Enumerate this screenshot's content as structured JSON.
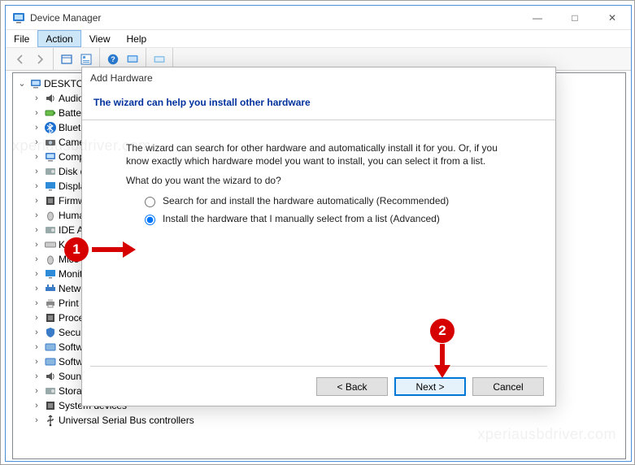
{
  "window": {
    "title": "Device Manager",
    "menu": [
      "File",
      "Action",
      "View",
      "Help"
    ],
    "menu_selected_index": 1,
    "controls": {
      "minimize": "—",
      "maximize": "□",
      "close": "✕"
    }
  },
  "toolbar": {
    "items": [
      {
        "name": "back-icon",
        "interact": false
      },
      {
        "name": "forward-icon",
        "interact": false
      },
      {
        "name": "show-hidden-icon",
        "interact": true
      },
      {
        "name": "refresh-icon",
        "interact": true
      },
      {
        "name": "help-icon",
        "interact": true
      },
      {
        "name": "scan-hardware-icon",
        "interact": true
      }
    ]
  },
  "tree": {
    "root": "DESKTOP-",
    "children": [
      "Audio inputs and outputs",
      "Batteries",
      "Bluetooth",
      "Cameras",
      "Computer",
      "Disk drives",
      "Display adapters",
      "Firmware",
      "Human Interface Devices",
      "IDE ATA/ATAPI controllers",
      "Keyboards",
      "Mice and other pointing devices",
      "Monitors",
      "Network adapters",
      "Print queues",
      "Processors",
      "Security devices",
      "Software components",
      "Software devices",
      "Sound, video and game controllers",
      "Storage controllers",
      "System devices",
      "Universal Serial Bus controllers"
    ]
  },
  "dialog": {
    "header": "Add Hardware",
    "title": "The wizard can help you install other hardware",
    "intro1": "The wizard can search for other hardware and automatically install it for you. Or, if you know exactly which hardware model you want to install, you can select it from a list.",
    "question": "What do you want the wizard to do?",
    "option1": "Search for and install the hardware automatically (Recommended)",
    "option2": "Install the hardware that I manually select from a list (Advanced)",
    "selected_option": 2,
    "buttons": {
      "back": "< Back",
      "next": "Next >",
      "cancel": "Cancel"
    }
  },
  "annotations": {
    "step1": "1",
    "step2": "2"
  },
  "watermark": "xperiausbdriver.com"
}
